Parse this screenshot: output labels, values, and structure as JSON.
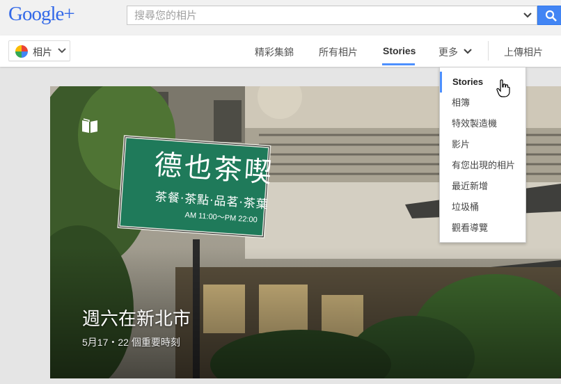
{
  "header": {
    "logo_text": "Google+",
    "search_placeholder": "搜尋您的相片"
  },
  "subnav": {
    "app_label": "相片",
    "tabs": [
      {
        "label": "精彩集錦"
      },
      {
        "label": "所有相片"
      },
      {
        "label": "Stories"
      },
      {
        "label": "更多"
      }
    ],
    "upload_label": "上傳相片"
  },
  "story": {
    "title": "週六在新北市",
    "subtitle": "5月17・22 個重要時刻",
    "sign_main": "德也茶喫",
    "sign_line2": "茶餐‧茶點‧品茗‧茶葉",
    "sign_line3": "AM 11:00～PM 22:00"
  },
  "menu": {
    "items": [
      {
        "label": "Stories"
      },
      {
        "label": "相簿"
      },
      {
        "label": "特效製造機"
      },
      {
        "label": "影片"
      },
      {
        "label": "有您出現的相片"
      },
      {
        "label": "最近新增"
      },
      {
        "label": "垃圾桶"
      },
      {
        "label": "觀看導覽"
      }
    ]
  },
  "colors": {
    "accent": "#4d90fe",
    "search_button": "#4285f4",
    "sign_green": "#1f7a5a"
  }
}
